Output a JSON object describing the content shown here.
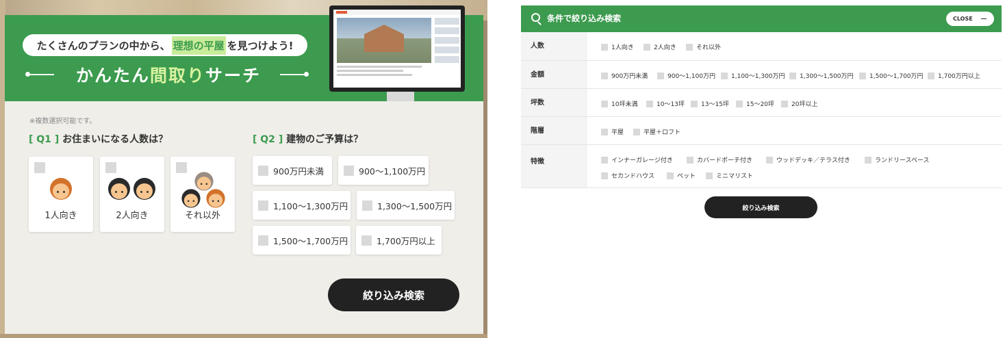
{
  "left": {
    "subtitle": {
      "before": "たくさんのプランの中から、",
      "highlight": "理想の平屋",
      "after": "を見つけよう!"
    },
    "title": {
      "part1": "かんたん",
      "accent": "間取り",
      "part2": "サーチ"
    },
    "note": "※複数選択可能です。",
    "q1": {
      "bracket_open": "[",
      "num": "Q1",
      "bracket_close": "]",
      "text": "お住まいになる人数は？"
    },
    "q2": {
      "bracket_open": "[",
      "num": "Q2",
      "bracket_close": "]",
      "text": "建物のご予算は？"
    },
    "people": [
      {
        "label": "1人向き"
      },
      {
        "label": "2人向き"
      },
      {
        "label": "それ以外"
      }
    ],
    "budget": [
      {
        "label": "900万円未満"
      },
      {
        "label": "900〜1,100万円"
      },
      {
        "label": "1,100〜1,300万円"
      },
      {
        "label": "1,300〜1,500万円"
      },
      {
        "label": "1,500〜1,700万円"
      },
      {
        "label": "1,700万円以上"
      }
    ],
    "search_label": "絞り込み検索",
    "colors": {
      "green": "#3c9b4e",
      "highlight": "#c9ec9a",
      "button": "#222222"
    }
  },
  "right": {
    "header_title": "条件で絞り込み検索",
    "close_label": "CLOSE",
    "rows": [
      {
        "label": "人数",
        "options": [
          "1人向き",
          "2人向き",
          "それ以外"
        ]
      },
      {
        "label": "金額",
        "options": [
          "900万円未満",
          "900〜1,100万円",
          "1,100〜1,300万円",
          "1,300〜1,500万円",
          "1,500〜1,700万円",
          "1,700万円以上"
        ]
      },
      {
        "label": "坪数",
        "options": [
          "10坪未満",
          "10〜13坪",
          "13〜15坪",
          "15〜20坪",
          "20坪以上"
        ]
      },
      {
        "label": "階層",
        "options": [
          "平屋",
          "平屋＋ロフト"
        ]
      },
      {
        "label": "特徴",
        "options": [
          "インナーガレージ付き",
          "カバードポーチ付き",
          "ウッドデッキ／テラス付き",
          "ランドリースペース",
          "セカンドハウス",
          "ペット",
          "ミニマリスト"
        ]
      }
    ],
    "search_label": "絞り込み検索"
  }
}
